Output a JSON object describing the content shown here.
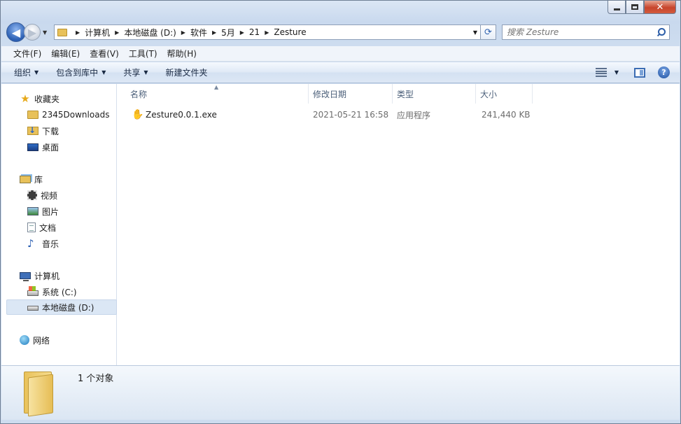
{
  "window": {
    "caption_min": "",
    "caption_max": "",
    "caption_close": "✕"
  },
  "nav": {
    "back_glyph": "◀",
    "forward_glyph": "▶"
  },
  "address": {
    "crumbs": [
      "计算机",
      "本地磁盘 (D:)",
      "软件",
      "5月",
      "21",
      "Zesture"
    ]
  },
  "search": {
    "placeholder": "搜索 Zesture"
  },
  "menu": {
    "items": [
      "文件(F)",
      "编辑(E)",
      "查看(V)",
      "工具(T)",
      "帮助(H)"
    ]
  },
  "commands": {
    "organize": "组织",
    "include_library": "包含到库中",
    "share": "共享",
    "new_folder": "新建文件夹",
    "help": "?"
  },
  "sidebar": {
    "favorites": {
      "label": "收藏夹",
      "items": [
        "2345Downloads",
        "下载",
        "桌面"
      ]
    },
    "libraries": {
      "label": "库",
      "items": [
        "视频",
        "图片",
        "文档",
        "音乐"
      ]
    },
    "computer": {
      "label": "计算机",
      "items": [
        "系统 (C:)",
        "本地磁盘 (D:)"
      ]
    },
    "network": {
      "label": "网络"
    }
  },
  "columns": {
    "name": "名称",
    "modified": "修改日期",
    "type": "类型",
    "size": "大小"
  },
  "files": [
    {
      "name": "Zesture0.0.1.exe",
      "modified": "2021-05-21 16:58",
      "type": "应用程序",
      "size": "241,440 KB",
      "icon": "waving-hand-icon"
    }
  ],
  "status": {
    "count": "1 个对象"
  },
  "colors": {
    "accent": "#2b5fb3",
    "selection": "#dbe7f5"
  }
}
